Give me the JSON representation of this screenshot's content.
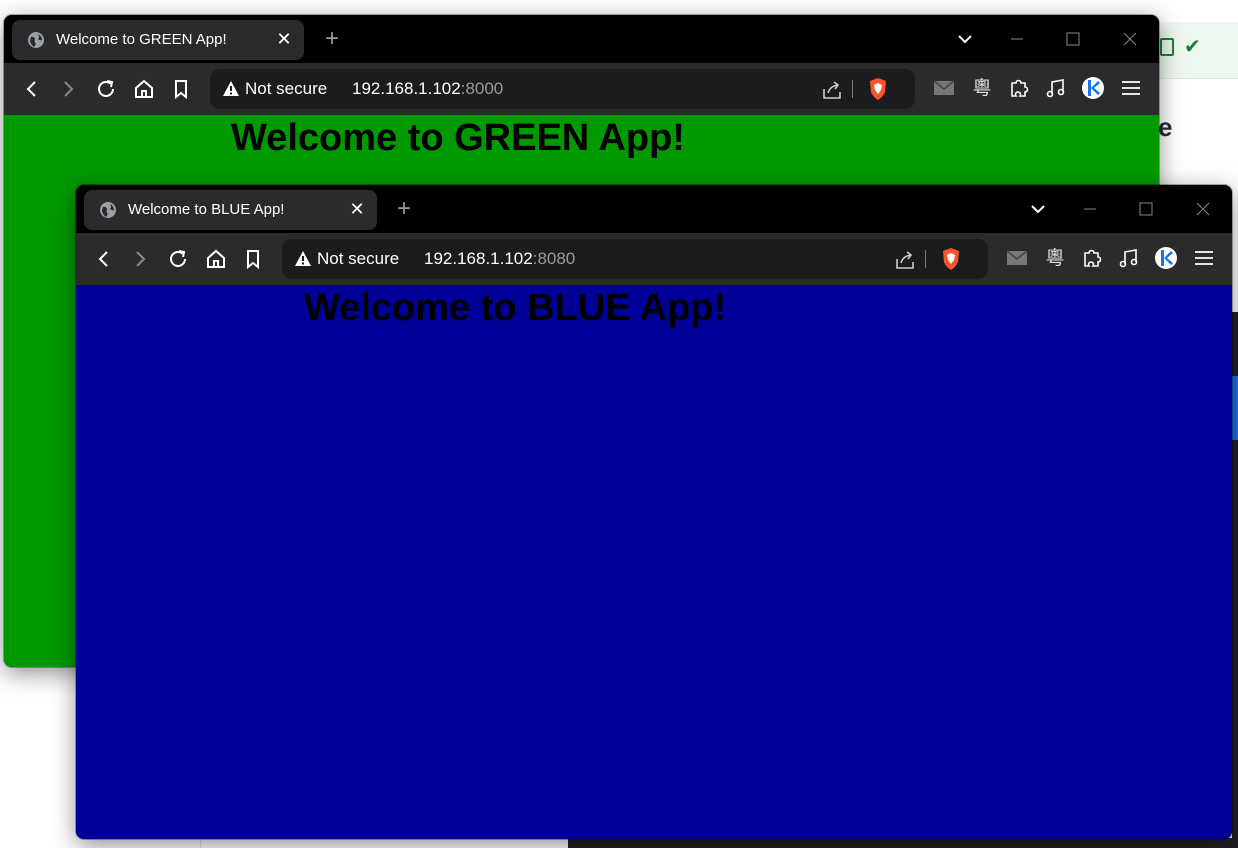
{
  "background": {
    "partial_heading_char": "e",
    "colors": {
      "sheet_green": "#188038",
      "dark_bar": "#202124",
      "accent_blue": "#1a73e8"
    }
  },
  "windows": [
    {
      "id": "green",
      "tab_title": "Welcome to GREEN App!",
      "omnibox": {
        "security_label": "Not secure",
        "host": "192.168.1.102",
        "port": ":8000"
      },
      "page": {
        "heading": "Welcome to GREEN App!",
        "background": "#009900"
      }
    },
    {
      "id": "blue",
      "tab_title": "Welcome to BLUE App!",
      "omnibox": {
        "security_label": "Not secure",
        "host": "192.168.1.102",
        "port": ":8080"
      },
      "page": {
        "heading": "Welcome to BLUE App!",
        "background": "#000099"
      }
    }
  ],
  "icons": {
    "tab": [
      "globe-icon",
      "close-icon",
      "new-tab-icon"
    ],
    "window_controls": [
      "tab-search-chevron-icon",
      "minimize-icon",
      "maximize-icon",
      "close-window-icon"
    ],
    "navigation": [
      "back-icon",
      "forward-icon",
      "reload-icon",
      "home-icon",
      "bookmark-icon"
    ],
    "omnibox": [
      "warning-icon",
      "share-icon",
      "brave-shields-icon"
    ],
    "extensions": [
      "mail-icon",
      "cantonese-char-icon",
      "extensions-puzzle-icon",
      "music-note-icon",
      "kodi-icon",
      "menu-icon"
    ]
  }
}
